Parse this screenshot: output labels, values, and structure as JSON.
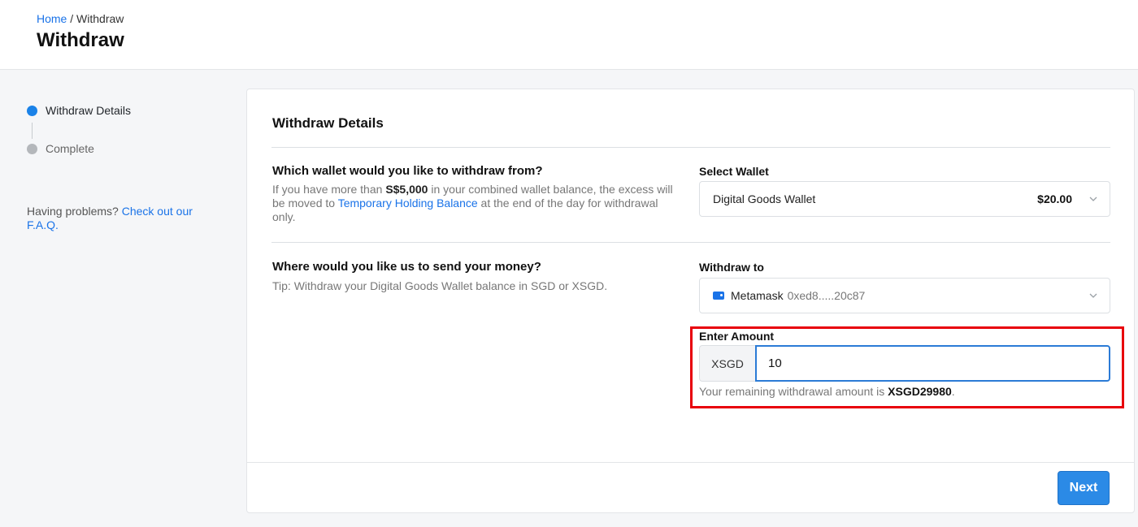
{
  "breadcrumb": {
    "home": "Home",
    "separator": "/",
    "current": "Withdraw"
  },
  "page_title": "Withdraw",
  "stepper": {
    "steps": [
      {
        "label": "Withdraw Details",
        "state": "active"
      },
      {
        "label": "Complete",
        "state": "inactive"
      }
    ]
  },
  "help": {
    "text": "Having problems?",
    "link": "Check out our F.A.Q."
  },
  "card": {
    "title": "Withdraw Details",
    "wallet_question": {
      "title": "Which wallet would you like to withdraw from?",
      "desc_1": "If you have more than ",
      "desc_bold": "S$5,000",
      "desc_2": " in your combined wallet balance, the excess will be moved to ",
      "desc_link": "Temporary Holding Balance",
      "desc_3": " at the end of the day for withdrawal only."
    },
    "select_wallet": {
      "label": "Select Wallet",
      "value": "Digital Goods Wallet",
      "amount": "$20.00"
    },
    "destination_question": {
      "title": "Where would you like us to send your money?",
      "tip": "Tip: Withdraw your Digital Goods Wallet balance in SGD or XSGD."
    },
    "withdraw_to": {
      "label": "Withdraw to",
      "value": "Metamask",
      "address": "0xed8.....20c87"
    },
    "amount": {
      "label": "Enter Amount",
      "currency": "XSGD",
      "value": "10",
      "remaining_prefix": "Your remaining withdrawal amount is ",
      "remaining_value": "XSGD29980",
      "remaining_suffix": "."
    },
    "next_label": "Next"
  },
  "colors": {
    "accent": "#1a82e8",
    "highlight": "#e8000b",
    "button": "#2b8ae6"
  }
}
